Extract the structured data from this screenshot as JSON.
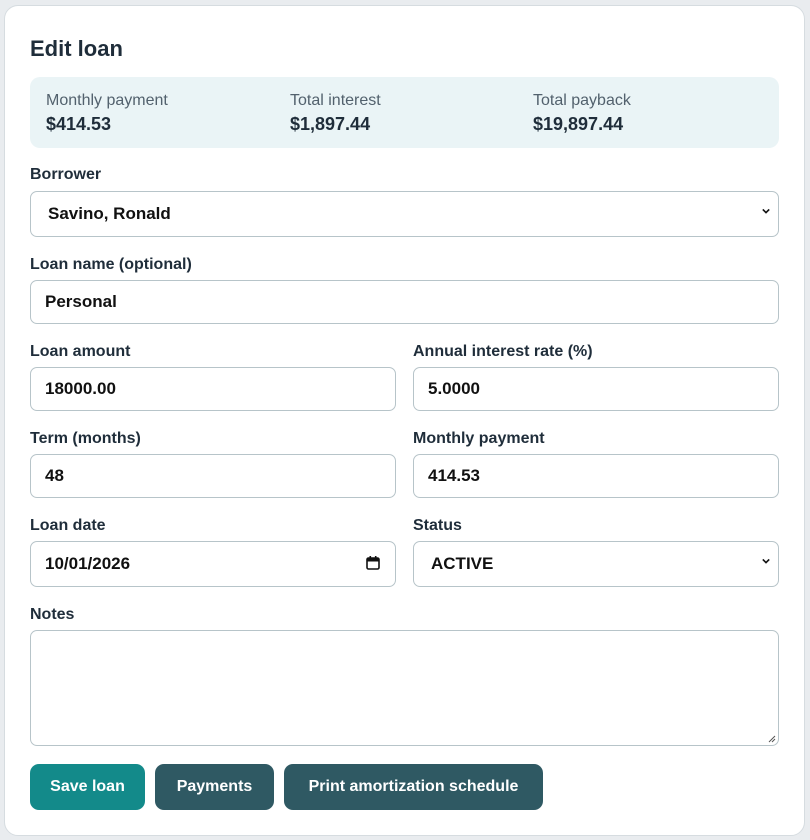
{
  "page": {
    "title": "Edit loan"
  },
  "summary": {
    "monthly_payment": {
      "label": "Monthly payment",
      "value": "$414.53"
    },
    "total_interest": {
      "label": "Total interest",
      "value": "$1,897.44"
    },
    "total_payback": {
      "label": "Total payback",
      "value": "$19,897.44"
    }
  },
  "form": {
    "borrower": {
      "label": "Borrower",
      "value": "Savino, Ronald"
    },
    "loan_name": {
      "label": "Loan name (optional)",
      "value": "Personal"
    },
    "loan_amount": {
      "label": "Loan amount",
      "value": "18000.00"
    },
    "interest_rate": {
      "label": "Annual interest rate (%)",
      "value": "5.0000"
    },
    "term": {
      "label": "Term (months)",
      "value": "48"
    },
    "monthly_payment": {
      "label": "Monthly payment",
      "value": "414.53"
    },
    "loan_date": {
      "label": "Loan date",
      "value": "10/01/2026"
    },
    "status": {
      "label": "Status",
      "value": "ACTIVE"
    },
    "notes": {
      "label": "Notes",
      "value": ""
    }
  },
  "actions": {
    "save": "Save loan",
    "payments": "Payments",
    "print": "Print amortization schedule"
  },
  "colors": {
    "primary_button": "#138a8a",
    "secondary_button": "#2f5963",
    "summary_background": "#eaf4f6"
  }
}
